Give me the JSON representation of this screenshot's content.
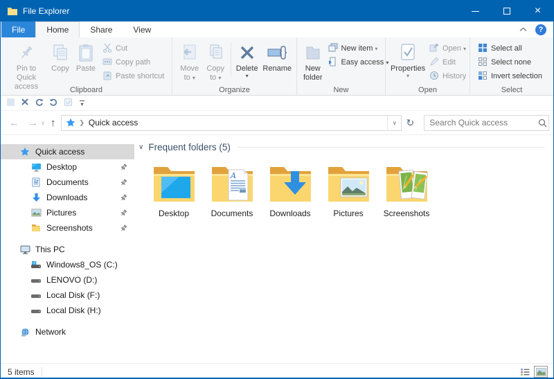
{
  "window": {
    "title": "File Explorer"
  },
  "tabs": {
    "file": "File",
    "home": "Home",
    "share": "Share",
    "view": "View"
  },
  "ribbon": {
    "clipboard": {
      "group_label": "Clipboard",
      "pin": "Pin to Quick access",
      "copy": "Copy",
      "paste": "Paste",
      "cut": "Cut",
      "copy_path": "Copy path",
      "paste_shortcut": "Paste shortcut"
    },
    "organize": {
      "group_label": "Organize",
      "move_to": "Move to",
      "copy_to": "Copy to",
      "delete": "Delete",
      "rename": "Rename"
    },
    "new": {
      "group_label": "New",
      "new_folder": "New folder",
      "new_item": "New item",
      "easy_access": "Easy access"
    },
    "open": {
      "group_label": "Open",
      "properties": "Properties",
      "open": "Open",
      "edit": "Edit",
      "history": "History"
    },
    "select": {
      "group_label": "Select",
      "select_all": "Select all",
      "select_none": "Select none",
      "invert_selection": "Invert selection"
    }
  },
  "address_bar": {
    "location": "Quick access",
    "search_placeholder": "Search Quick access"
  },
  "sidebar": {
    "items": [
      {
        "label": "Quick access",
        "icon": "quick-access-star-icon",
        "selected": true
      },
      {
        "label": "Desktop",
        "icon": "desktop-icon",
        "pinned": true
      },
      {
        "label": "Documents",
        "icon": "documents-icon",
        "pinned": true
      },
      {
        "label": "Downloads",
        "icon": "downloads-icon",
        "pinned": true
      },
      {
        "label": "Pictures",
        "icon": "pictures-icon",
        "pinned": true
      },
      {
        "label": "Screenshots",
        "icon": "folder-icon",
        "pinned": true
      },
      {
        "label": "This PC",
        "icon": "this-pc-icon"
      },
      {
        "label": "Windows8_OS (C:)",
        "icon": "os-drive-icon"
      },
      {
        "label": "LENOVO (D:)",
        "icon": "drive-icon"
      },
      {
        "label": "Local Disk (F:)",
        "icon": "drive-icon"
      },
      {
        "label": "Local Disk (H:)",
        "icon": "drive-icon"
      },
      {
        "label": "Network",
        "icon": "network-icon"
      }
    ]
  },
  "content": {
    "section_header": "Frequent folders (5)",
    "tiles": [
      {
        "label": "Desktop",
        "icon": "desktop-folder-icon"
      },
      {
        "label": "Documents",
        "icon": "documents-folder-icon"
      },
      {
        "label": "Downloads",
        "icon": "downloads-folder-icon"
      },
      {
        "label": "Pictures",
        "icon": "pictures-folder-icon"
      },
      {
        "label": "Screenshots",
        "icon": "screenshots-folder-icon"
      }
    ]
  },
  "status_bar": {
    "items_count": "5 items"
  },
  "colors": {
    "titlebar": "#0063B1",
    "file_tab": "#2B86D9",
    "accent_blue": "#2F8FE3",
    "folder_front": "#FBD66F",
    "folder_back": "#E2A23B",
    "disabled_icon": "#c7d5e6",
    "enabled_icon": "#5F7CA0"
  }
}
